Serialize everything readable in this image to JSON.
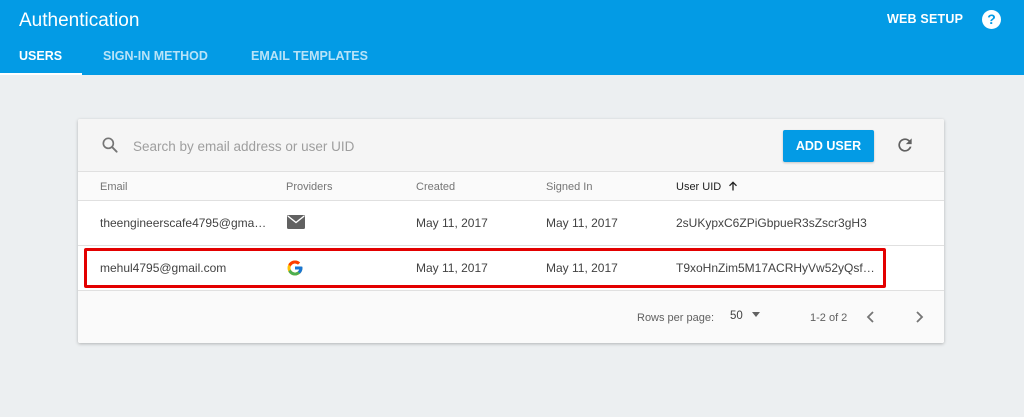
{
  "header": {
    "title": "Authentication",
    "web_setup": "WEB SETUP",
    "help": "?",
    "tabs": [
      {
        "label": "USERS",
        "active": true
      },
      {
        "label": "SIGN-IN METHOD",
        "active": false
      },
      {
        "label": "EMAIL TEMPLATES",
        "active": false
      }
    ]
  },
  "toolbar": {
    "search_placeholder": "Search by email address or user UID",
    "search_value": "",
    "add_user_label": "ADD USER",
    "refresh_icon": "refresh-icon"
  },
  "table": {
    "columns": [
      "Email",
      "Providers",
      "Created",
      "Signed In",
      "User UID"
    ],
    "sorted_column": "User UID",
    "sort_direction": "ascending",
    "rows": [
      {
        "email": "theengineerscafe4795@gma…",
        "provider": "email-icon",
        "created": "May 11, 2017",
        "signed_in": "May 11, 2017",
        "uid": "2sUKypxC6ZPiGbpueR3sZscr3gH3"
      },
      {
        "email": "mehul4795@gmail.com",
        "provider": "google-icon",
        "created": "May 11, 2017",
        "signed_in": "May 11, 2017",
        "uid": "T9xoHnZim5M17ACRHyVw52yQsf…",
        "highlighted": true
      }
    ]
  },
  "pagination": {
    "rows_per_page_label": "Rows per page:",
    "rows_per_page_value": "50",
    "range": "1-2 of 2"
  },
  "colors": {
    "brand": "#039be5",
    "highlight": "#e30000",
    "background": "#eceff1"
  }
}
